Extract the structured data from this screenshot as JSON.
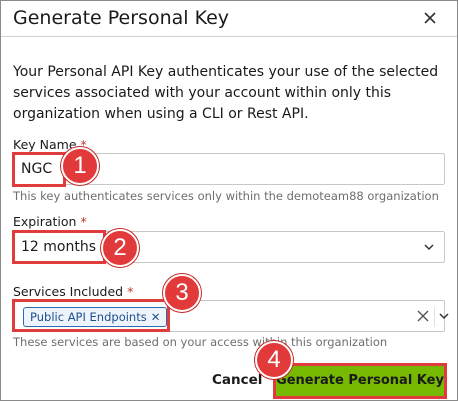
{
  "dialog": {
    "title": "Generate Personal Key",
    "close_icon": "close-icon",
    "description": "Your Personal API Key authenticates your use of the selected services associated with your account within only this organization when using a CLI or Rest API."
  },
  "key_name": {
    "label": "Key Name",
    "required_mark": "*",
    "value": "NGC",
    "helper": "This key authenticates services only within the demoteam88 organization"
  },
  "expiration": {
    "label": "Expiration",
    "required_mark": "*",
    "value": "12 months",
    "icon": "chevron-down-icon"
  },
  "services": {
    "label": "Services Included",
    "required_mark": "*",
    "tags": [
      "Public API Endpoints"
    ],
    "tag_remove_glyph": "✕",
    "helper": "These services are based on your access within this organization"
  },
  "footer": {
    "cancel_label": "Cancel",
    "primary_label": "Generate Personal Key"
  },
  "annotations": [
    "1",
    "2",
    "3",
    "4"
  ],
  "colors": {
    "accent_green": "#76b900",
    "highlight_red": "#e03c3c",
    "tag_blue": "#2a6bb3"
  }
}
